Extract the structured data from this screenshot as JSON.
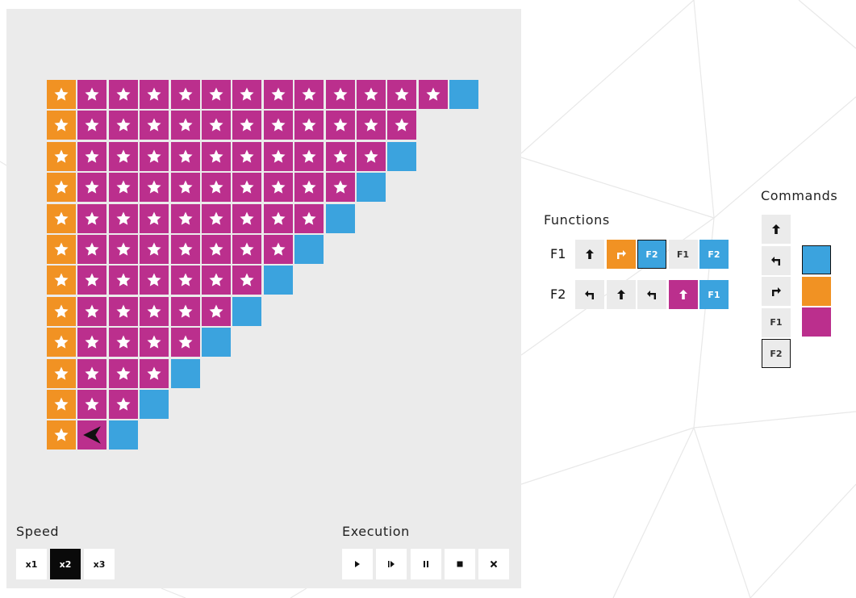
{
  "colors": {
    "blue": "#3ba3de",
    "orange": "#f19223",
    "magenta": "#bb2f8d",
    "panel": "#ebebeb",
    "slot": "#ebebeb",
    "dark": "#0a0a0a"
  },
  "board": {
    "rows": [
      {
        "orange": 1,
        "magenta": 12,
        "blue": 1
      },
      {
        "orange": 1,
        "magenta": 11,
        "blue": 0
      },
      {
        "orange": 1,
        "magenta": 10,
        "blue": 1
      },
      {
        "orange": 1,
        "magenta": 9,
        "blue": 1
      },
      {
        "orange": 1,
        "magenta": 8,
        "blue": 1
      },
      {
        "orange": 1,
        "magenta": 7,
        "blue": 1
      },
      {
        "orange": 1,
        "magenta": 6,
        "blue": 1
      },
      {
        "orange": 1,
        "magenta": 5,
        "blue": 1
      },
      {
        "orange": 1,
        "magenta": 4,
        "blue": 1
      },
      {
        "orange": 1,
        "magenta": 3,
        "blue": 1
      },
      {
        "orange": 1,
        "magenta": 2,
        "blue": 1
      },
      {
        "orange": 1,
        "magenta": 1,
        "blue": 1
      }
    ],
    "ship": {
      "row": 11,
      "col": 1,
      "direction": "left"
    }
  },
  "speed": {
    "label": "Speed",
    "options": [
      "x1",
      "x2",
      "x3"
    ],
    "selected": "x2"
  },
  "execution": {
    "label": "Execution",
    "buttons": [
      {
        "name": "play-button",
        "icon": "play-icon"
      },
      {
        "name": "step-button",
        "icon": "step-icon"
      },
      {
        "name": "pause-button",
        "icon": "pause-icon"
      },
      {
        "name": "stop-button",
        "icon": "stop-icon"
      },
      {
        "name": "clear-button",
        "icon": "close-icon"
      }
    ]
  },
  "functions": {
    "label": "Functions",
    "list": [
      {
        "name": "F1",
        "slots": [
          {
            "cmd": "forward",
            "color": "none"
          },
          {
            "cmd": "right",
            "color": "orange"
          },
          {
            "cmd": "F2",
            "color": "blue",
            "selected": true
          },
          {
            "cmd": "F1",
            "color": "none"
          },
          {
            "cmd": "F2",
            "color": "blue"
          }
        ]
      },
      {
        "name": "F2",
        "slots": [
          {
            "cmd": "left",
            "color": "none"
          },
          {
            "cmd": "forward",
            "color": "none"
          },
          {
            "cmd": "left",
            "color": "none"
          },
          {
            "cmd": "forward",
            "color": "magenta"
          },
          {
            "cmd": "F1",
            "color": "blue"
          }
        ]
      }
    ]
  },
  "commands": {
    "label": "Commands",
    "items": [
      "forward",
      "left",
      "right",
      "F1",
      "F2"
    ],
    "selected": "F2",
    "color_swatches": [
      "blue",
      "orange",
      "magenta"
    ]
  }
}
